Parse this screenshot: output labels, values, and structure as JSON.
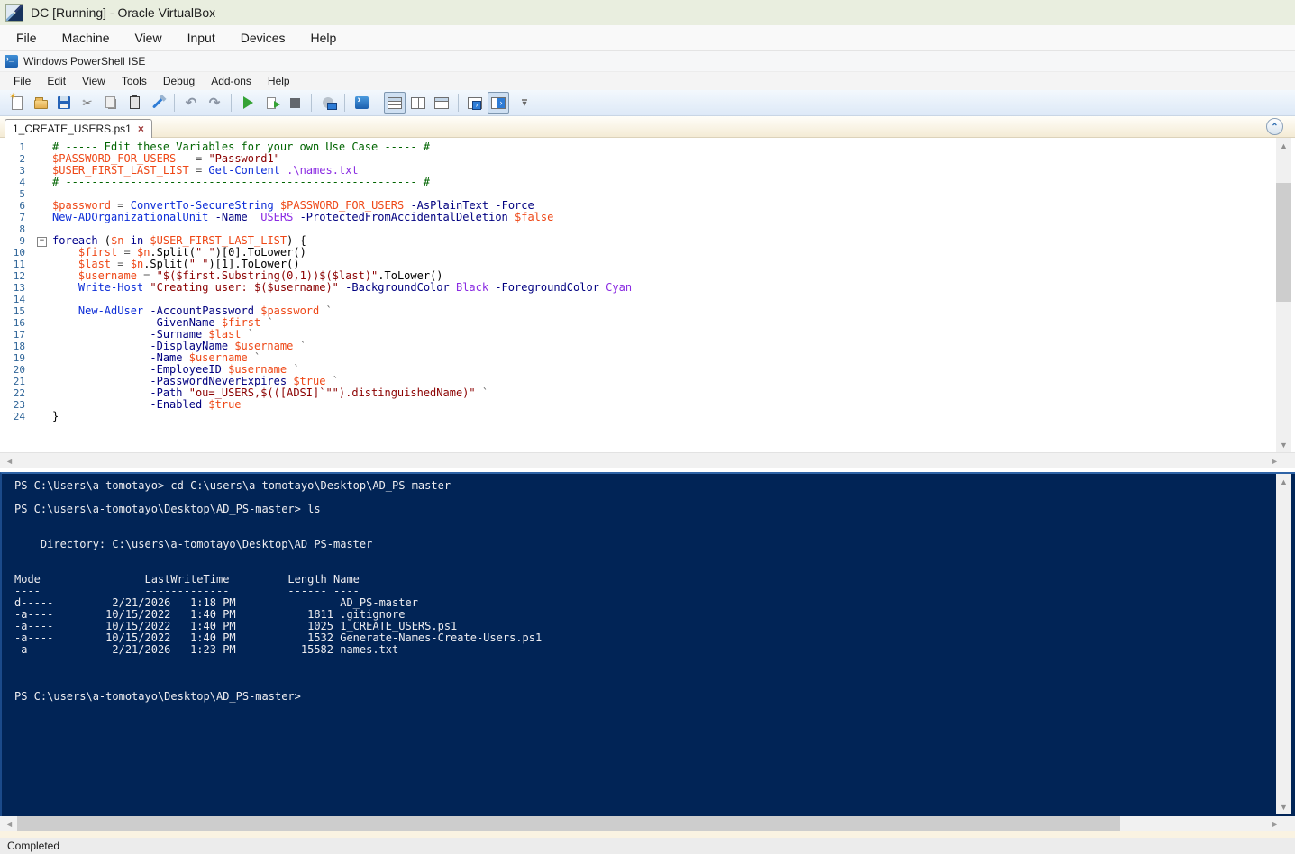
{
  "vbox": {
    "title": "DC [Running] - Oracle VirtualBox",
    "menu": [
      "File",
      "Machine",
      "View",
      "Input",
      "Devices",
      "Help"
    ]
  },
  "ise": {
    "title": "Windows PowerShell ISE",
    "menu": [
      "File",
      "Edit",
      "View",
      "Tools",
      "Debug",
      "Add-ons",
      "Help"
    ],
    "toolbar": [
      {
        "icon": "new-script-icon"
      },
      {
        "icon": "open-script-icon"
      },
      {
        "icon": "save-icon"
      },
      {
        "icon": "cut-icon"
      },
      {
        "icon": "copy-icon"
      },
      {
        "icon": "paste-icon"
      },
      {
        "icon": "clear-console-icon"
      },
      "|",
      {
        "icon": "undo-icon"
      },
      {
        "icon": "redo-icon"
      },
      "|",
      {
        "icon": "run-script-icon"
      },
      {
        "icon": "run-selection-icon"
      },
      {
        "icon": "stop-operation-icon"
      },
      "|",
      {
        "icon": "new-remote-powershell-tab-icon"
      },
      "|",
      {
        "icon": "start-powershell-exe-icon"
      },
      "|",
      {
        "icon": "show-script-pane-top-icon",
        "pressed": true
      },
      {
        "icon": "show-script-pane-right-icon"
      },
      {
        "icon": "show-script-pane-maximized-icon"
      },
      "|",
      {
        "icon": "new-powershell-tab-icon"
      },
      {
        "icon": "show-script-pane-toggle-icon",
        "pressed": true
      },
      {
        "icon": "toolbar-overflow-icon"
      }
    ],
    "tab": {
      "label": "1_CREATE_USERS.ps1",
      "close_glyph": "×"
    },
    "collapse_glyph": "⌃"
  },
  "editor": {
    "token_colors": {
      "comment": "#006400",
      "string": "#8B0000",
      "variable": "#ee4716",
      "command": "#0c2dd8",
      "parameter": "#000080",
      "keyword": "#00008B",
      "argument": "#8A2BE2",
      "operator": "#5a5a5a",
      "plain": "#000000"
    },
    "lines": [
      {
        "n": 1,
        "g": "",
        "s": [
          [
            "comment",
            "# ----- Edit these Variables for your own Use Case ----- #"
          ]
        ]
      },
      {
        "n": 2,
        "g": "",
        "s": [
          [
            "variable",
            "$PASSWORD_FOR_USERS"
          ],
          [
            "plain",
            "   "
          ],
          [
            "operator",
            "="
          ],
          [
            "plain",
            " "
          ],
          [
            "string",
            "\"Password1\""
          ]
        ]
      },
      {
        "n": 3,
        "g": "",
        "s": [
          [
            "variable",
            "$USER_FIRST_LAST_LIST"
          ],
          [
            "plain",
            " "
          ],
          [
            "operator",
            "="
          ],
          [
            "plain",
            " "
          ],
          [
            "command",
            "Get-Content"
          ],
          [
            "plain",
            " "
          ],
          [
            "argument",
            ".\\names.txt"
          ]
        ]
      },
      {
        "n": 4,
        "g": "",
        "s": [
          [
            "comment",
            "# ------------------------------------------------------ #"
          ]
        ]
      },
      {
        "n": 5,
        "g": "",
        "s": []
      },
      {
        "n": 6,
        "g": "",
        "s": [
          [
            "variable",
            "$password"
          ],
          [
            "plain",
            " "
          ],
          [
            "operator",
            "="
          ],
          [
            "plain",
            " "
          ],
          [
            "command",
            "ConvertTo-SecureString"
          ],
          [
            "plain",
            " "
          ],
          [
            "variable",
            "$PASSWORD_FOR_USERS"
          ],
          [
            "plain",
            " "
          ],
          [
            "parameter",
            "-AsPlainText"
          ],
          [
            "plain",
            " "
          ],
          [
            "parameter",
            "-Force"
          ]
        ]
      },
      {
        "n": 7,
        "g": "",
        "s": [
          [
            "command",
            "New-ADOrganizationalUnit"
          ],
          [
            "plain",
            " "
          ],
          [
            "parameter",
            "-Name"
          ],
          [
            "plain",
            " "
          ],
          [
            "argument",
            "_USERS"
          ],
          [
            "plain",
            " "
          ],
          [
            "parameter",
            "-ProtectedFromAccidentalDeletion"
          ],
          [
            "plain",
            " "
          ],
          [
            "variable",
            "$false"
          ]
        ]
      },
      {
        "n": 8,
        "g": "",
        "s": []
      },
      {
        "n": 9,
        "g": "box",
        "s": [
          [
            "keyword",
            "foreach"
          ],
          [
            "plain",
            " ("
          ],
          [
            "variable",
            "$n"
          ],
          [
            "plain",
            " "
          ],
          [
            "keyword",
            "in"
          ],
          [
            "plain",
            " "
          ],
          [
            "variable",
            "$USER_FIRST_LAST_LIST"
          ],
          [
            "plain",
            ") {"
          ]
        ]
      },
      {
        "n": 10,
        "g": "bar",
        "s": [
          [
            "plain",
            "    "
          ],
          [
            "variable",
            "$first"
          ],
          [
            "plain",
            " "
          ],
          [
            "operator",
            "="
          ],
          [
            "plain",
            " "
          ],
          [
            "variable",
            "$n"
          ],
          [
            "plain",
            ".Split("
          ],
          [
            "string",
            "\" \""
          ],
          [
            "plain",
            ")[0].ToLower()"
          ]
        ]
      },
      {
        "n": 11,
        "g": "bar",
        "s": [
          [
            "plain",
            "    "
          ],
          [
            "variable",
            "$last"
          ],
          [
            "plain",
            " "
          ],
          [
            "operator",
            "="
          ],
          [
            "plain",
            " "
          ],
          [
            "variable",
            "$n"
          ],
          [
            "plain",
            ".Split("
          ],
          [
            "string",
            "\" \""
          ],
          [
            "plain",
            ")[1].ToLower()"
          ]
        ]
      },
      {
        "n": 12,
        "g": "bar",
        "s": [
          [
            "plain",
            "    "
          ],
          [
            "variable",
            "$username"
          ],
          [
            "plain",
            " "
          ],
          [
            "operator",
            "="
          ],
          [
            "plain",
            " "
          ],
          [
            "string",
            "\"$($first.Substring(0,1))$($last)\""
          ],
          [
            "plain",
            ".ToLower()"
          ]
        ]
      },
      {
        "n": 13,
        "g": "bar",
        "s": [
          [
            "plain",
            "    "
          ],
          [
            "command",
            "Write-Host"
          ],
          [
            "plain",
            " "
          ],
          [
            "string",
            "\"Creating user: $($username)\""
          ],
          [
            "plain",
            " "
          ],
          [
            "parameter",
            "-BackgroundColor"
          ],
          [
            "plain",
            " "
          ],
          [
            "argument",
            "Black"
          ],
          [
            "plain",
            " "
          ],
          [
            "parameter",
            "-ForegroundColor"
          ],
          [
            "plain",
            " "
          ],
          [
            "argument",
            "Cyan"
          ]
        ]
      },
      {
        "n": 14,
        "g": "bar",
        "s": []
      },
      {
        "n": 15,
        "g": "bar",
        "s": [
          [
            "plain",
            "    "
          ],
          [
            "command",
            "New-AdUser"
          ],
          [
            "plain",
            " "
          ],
          [
            "parameter",
            "-AccountPassword"
          ],
          [
            "plain",
            " "
          ],
          [
            "variable",
            "$password"
          ],
          [
            "plain",
            " "
          ],
          [
            "operator",
            "`"
          ]
        ]
      },
      {
        "n": 16,
        "g": "bar",
        "s": [
          [
            "plain",
            "               "
          ],
          [
            "parameter",
            "-GivenName"
          ],
          [
            "plain",
            " "
          ],
          [
            "variable",
            "$first"
          ],
          [
            "plain",
            " "
          ],
          [
            "operator",
            "`"
          ]
        ]
      },
      {
        "n": 17,
        "g": "bar",
        "s": [
          [
            "plain",
            "               "
          ],
          [
            "parameter",
            "-Surname"
          ],
          [
            "plain",
            " "
          ],
          [
            "variable",
            "$last"
          ],
          [
            "plain",
            " "
          ],
          [
            "operator",
            "`"
          ]
        ]
      },
      {
        "n": 18,
        "g": "bar",
        "s": [
          [
            "plain",
            "               "
          ],
          [
            "parameter",
            "-DisplayName"
          ],
          [
            "plain",
            " "
          ],
          [
            "variable",
            "$username"
          ],
          [
            "plain",
            " "
          ],
          [
            "operator",
            "`"
          ]
        ]
      },
      {
        "n": 19,
        "g": "bar",
        "s": [
          [
            "plain",
            "               "
          ],
          [
            "parameter",
            "-Name"
          ],
          [
            "plain",
            " "
          ],
          [
            "variable",
            "$username"
          ],
          [
            "plain",
            " "
          ],
          [
            "operator",
            "`"
          ]
        ]
      },
      {
        "n": 20,
        "g": "bar",
        "s": [
          [
            "plain",
            "               "
          ],
          [
            "parameter",
            "-EmployeeID"
          ],
          [
            "plain",
            " "
          ],
          [
            "variable",
            "$username"
          ],
          [
            "plain",
            " "
          ],
          [
            "operator",
            "`"
          ]
        ]
      },
      {
        "n": 21,
        "g": "bar",
        "s": [
          [
            "plain",
            "               "
          ],
          [
            "parameter",
            "-PasswordNeverExpires"
          ],
          [
            "plain",
            " "
          ],
          [
            "variable",
            "$true"
          ],
          [
            "plain",
            " "
          ],
          [
            "operator",
            "`"
          ]
        ]
      },
      {
        "n": 22,
        "g": "bar",
        "s": [
          [
            "plain",
            "               "
          ],
          [
            "parameter",
            "-Path"
          ],
          [
            "plain",
            " "
          ],
          [
            "string",
            "\"ou=_USERS,$(([ADSI]`\"\").distinguishedName)\""
          ],
          [
            "plain",
            " "
          ],
          [
            "operator",
            "`"
          ]
        ]
      },
      {
        "n": 23,
        "g": "bar",
        "s": [
          [
            "plain",
            "               "
          ],
          [
            "parameter",
            "-Enabled"
          ],
          [
            "plain",
            " "
          ],
          [
            "variable",
            "$true"
          ]
        ]
      },
      {
        "n": 24,
        "g": "bar",
        "s": [
          [
            "plain",
            "}"
          ]
        ]
      }
    ]
  },
  "console": {
    "colors": {
      "background": "#012456",
      "text": "#eeedf0",
      "border_top": "#2e63a6"
    },
    "lines": [
      "PS C:\\Users\\a-tomotayo> cd C:\\users\\a-tomotayo\\Desktop\\AD_PS-master",
      "",
      "PS C:\\users\\a-tomotayo\\Desktop\\AD_PS-master> ls",
      "",
      "",
      "    Directory: C:\\users\\a-tomotayo\\Desktop\\AD_PS-master",
      "",
      "",
      "Mode                LastWriteTime         Length Name",
      "----                -------------         ------ ----",
      "d-----         2/21/2026   1:18 PM                AD_PS-master",
      "-a----        10/15/2022   1:40 PM           1811 .gitignore",
      "-a----        10/15/2022   1:40 PM           1025 1_CREATE_USERS.ps1",
      "-a----        10/15/2022   1:40 PM           1532 Generate-Names-Create-Users.ps1",
      "-a----         2/21/2026   1:23 PM          15582 names.txt",
      "",
      "",
      "",
      "PS C:\\users\\a-tomotayo\\Desktop\\AD_PS-master> "
    ]
  },
  "status": {
    "text": "Completed"
  }
}
